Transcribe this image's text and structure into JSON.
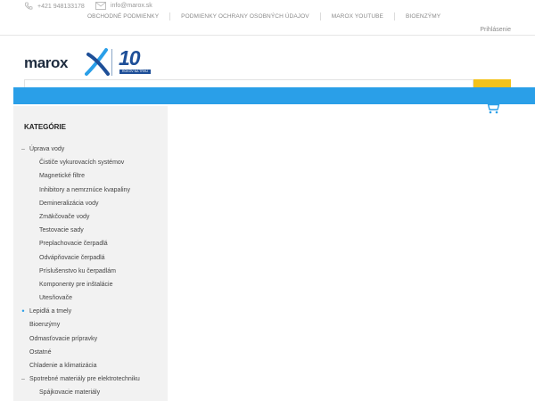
{
  "topbar": {
    "phone": "+421 948133178",
    "email": "info@marox.sk",
    "nav": [
      "OBCHODNÉ PODMIENKY",
      "PODMIENKY OCHRANY OSOBNÝCH ÚDAJOV",
      "MAROX YOUTUBE",
      "BIOENZÝMY"
    ],
    "login": "Prihlásenie"
  },
  "brand": {
    "name": "marox",
    "anniversary": "10",
    "anniversary_caption": "ROKOV NA TRHU",
    "colors": {
      "navy": "#1e2c3f",
      "blue": "#1e4f98",
      "accent": "#2a9fe8",
      "search_button": "#f3c21b"
    }
  },
  "icons": {
    "phone": "phone-icon",
    "email": "envelope-icon",
    "cart": "cart-icon"
  },
  "sidebar": {
    "title": "KATEGÓRIE",
    "categories": [
      {
        "label": "Úprava vody",
        "level": 0,
        "marker": "–"
      },
      {
        "label": "Čističe vykurovacích systémov",
        "level": 1
      },
      {
        "label": "Magnetické filtre",
        "level": 1
      },
      {
        "label": "Inhibitory a nemrznúce kvapaliny",
        "level": 1
      },
      {
        "label": "Demineralizácia vody",
        "level": 1
      },
      {
        "label": "Zmäkčovače vody",
        "level": 1
      },
      {
        "label": "Testovacie sady",
        "level": 1
      },
      {
        "label": "Preplachovacie čerpadlá",
        "level": 1
      },
      {
        "label": "Odvápňovacie čerpadlá",
        "level": 1
      },
      {
        "label": "Príslušenstvo ku čerpadlám",
        "level": 1
      },
      {
        "label": "Komponenty pre inštalácie",
        "level": 1
      },
      {
        "label": "Utesňovače",
        "level": 1
      },
      {
        "label": "Lepidlá a tmely",
        "level": 0,
        "marker": "•"
      },
      {
        "label": "Bioenzýmy",
        "level": 0
      },
      {
        "label": "Odmasťovacie prípravky",
        "level": 0
      },
      {
        "label": "Ostatné",
        "level": 0
      },
      {
        "label": "Chladenie a klimatizácia",
        "level": 0
      },
      {
        "label": "Spotrebné materiály pre elektrotechniku",
        "level": 0,
        "marker": "–"
      },
      {
        "label": "Spájkovacie materiály",
        "level": 1
      }
    ]
  }
}
